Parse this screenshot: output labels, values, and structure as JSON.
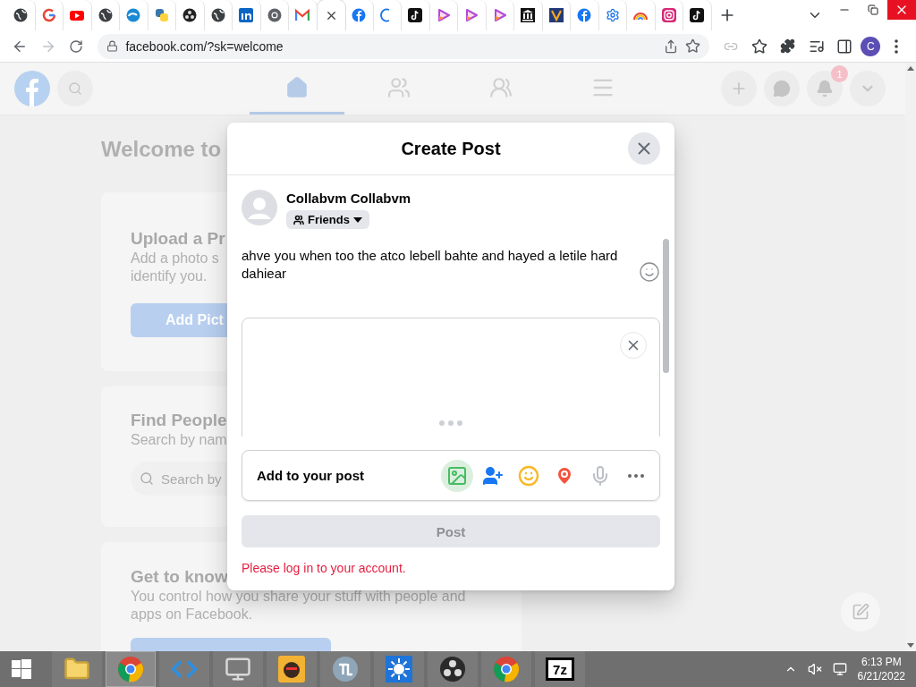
{
  "browser": {
    "tabs": [
      {
        "kind": "globe",
        "selected": false
      },
      {
        "kind": "google",
        "selected": false
      },
      {
        "kind": "youtube",
        "selected": false
      },
      {
        "kind": "globe",
        "selected": false
      },
      {
        "kind": "edge",
        "selected": false
      },
      {
        "kind": "python",
        "selected": false
      },
      {
        "kind": "obs",
        "selected": false
      },
      {
        "kind": "globe",
        "selected": false
      },
      {
        "kind": "linkedin",
        "selected": false
      },
      {
        "kind": "chrome",
        "selected": false
      },
      {
        "kind": "gmail",
        "selected": false
      },
      {
        "kind": "blank",
        "selected": true
      },
      {
        "kind": "facebook",
        "selected": false
      },
      {
        "kind": "loading",
        "selected": false
      },
      {
        "kind": "tiktok",
        "selected": false
      },
      {
        "kind": "play",
        "selected": false
      },
      {
        "kind": "play",
        "selected": false
      },
      {
        "kind": "play",
        "selected": false
      },
      {
        "kind": "bank",
        "selected": false
      },
      {
        "kind": "vee",
        "selected": false
      },
      {
        "kind": "facebook",
        "selected": false
      },
      {
        "kind": "gear",
        "selected": false
      },
      {
        "kind": "rainbow",
        "selected": false
      },
      {
        "kind": "instagram",
        "selected": false
      },
      {
        "kind": "tiktok",
        "selected": false
      }
    ],
    "address": "facebook.com/?sk=welcome",
    "profile": "C"
  },
  "page": {
    "nav": [
      {
        "kind": "home",
        "selected": true
      },
      {
        "kind": "friends",
        "selected": false
      },
      {
        "kind": "groups",
        "selected": false
      },
      {
        "kind": "menu",
        "selected": false
      }
    ],
    "notifications_badge": "1",
    "welcome": "Welcome to",
    "cards": [
      {
        "kind": "button",
        "title": "Upload a Pr",
        "description": [
          "Add a photo s",
          "identify you."
        ],
        "action": "Add Pict"
      },
      {
        "kind": "search",
        "title": "Find People",
        "description": [
          "Search by nam"
        ],
        "action": "Search by"
      },
      {
        "kind": "cut_button",
        "title": "Get to know",
        "description": [
          "You control how you share your stuff with people and",
          "apps on Facebook."
        ]
      }
    ]
  },
  "dialog": {
    "title": "Create Post",
    "user": "Collabvm Collabvm",
    "audience": "Friends",
    "text": "ahve you when too the atco lebell bahte and hayed a letile hard dahiear",
    "add_to_post": "Add to your post",
    "tools": [
      {
        "kind": "photo",
        "selected": true
      },
      {
        "kind": "tag",
        "selected": false
      },
      {
        "kind": "feeling",
        "selected": false
      },
      {
        "kind": "location",
        "selected": false
      },
      {
        "kind": "mic",
        "selected": false
      },
      {
        "kind": "more",
        "selected": false
      }
    ],
    "post_button": {
      "label": "Post",
      "disabled": true
    },
    "error": "Please log in to your account."
  },
  "taskbar": {
    "items": [
      {
        "kind": "explorer",
        "selected": false
      },
      {
        "kind": "chrome",
        "selected": true
      },
      {
        "kind": "vscode",
        "selected": false
      },
      {
        "kind": "monitor",
        "selected": false
      },
      {
        "kind": "game",
        "selected": false
      },
      {
        "kind": "tl",
        "selected": false
      },
      {
        "kind": "sun",
        "selected": false
      },
      {
        "kind": "obs",
        "selected": false
      },
      {
        "kind": "chrome",
        "selected": false
      },
      {
        "kind": "archive",
        "selected": false,
        "label": "7z"
      }
    ],
    "time": "6:13 PM",
    "date": "6/21/2022"
  }
}
